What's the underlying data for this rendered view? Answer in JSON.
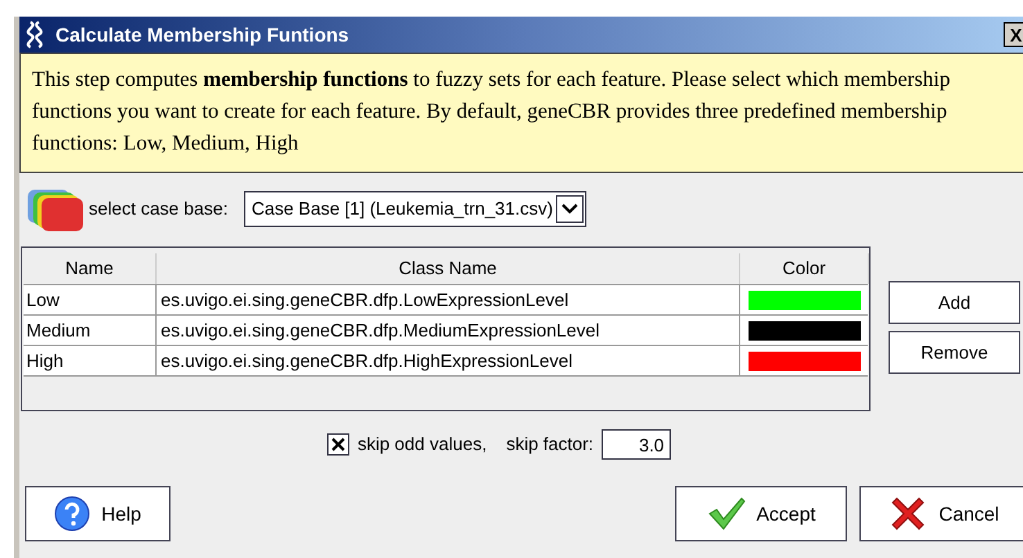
{
  "window": {
    "title": "Calculate Membership Funtions",
    "close": "X"
  },
  "info": "This step computes **membership functions** to fuzzy sets for each feature. Please select which membership functions you want to create for each feature. By default, geneCBR provides three predefined membership functions: Low, Medium, High",
  "case_base": {
    "label": "select case base:",
    "value": "Case Base [1] (Leukemia_trn_31.csv)"
  },
  "table": {
    "columns": [
      "Name",
      "Class Name",
      "Color"
    ],
    "rows": [
      {
        "name": "Low",
        "class_name": "es.uvigo.ei.sing.geneCBR.dfp.LowExpressionLevel",
        "color": "#00ff00"
      },
      {
        "name": "Medium",
        "class_name": "es.uvigo.ei.sing.geneCBR.dfp.MediumExpressionLevel",
        "color": "#000000"
      },
      {
        "name": "High",
        "class_name": "es.uvigo.ei.sing.geneCBR.dfp.HighExpressionLevel",
        "color": "#ff0000"
      }
    ]
  },
  "side_buttons": [
    "Add",
    "Remove"
  ],
  "skip": {
    "checked": true,
    "label": "skip odd values,",
    "factor_label": "skip factor:",
    "factor": "3.0"
  },
  "buttons": [
    {
      "kind": "help",
      "label": "Help"
    },
    {
      "kind": "accept",
      "label": "Accept"
    },
    {
      "kind": "cancel",
      "label": "Cancel"
    }
  ]
}
